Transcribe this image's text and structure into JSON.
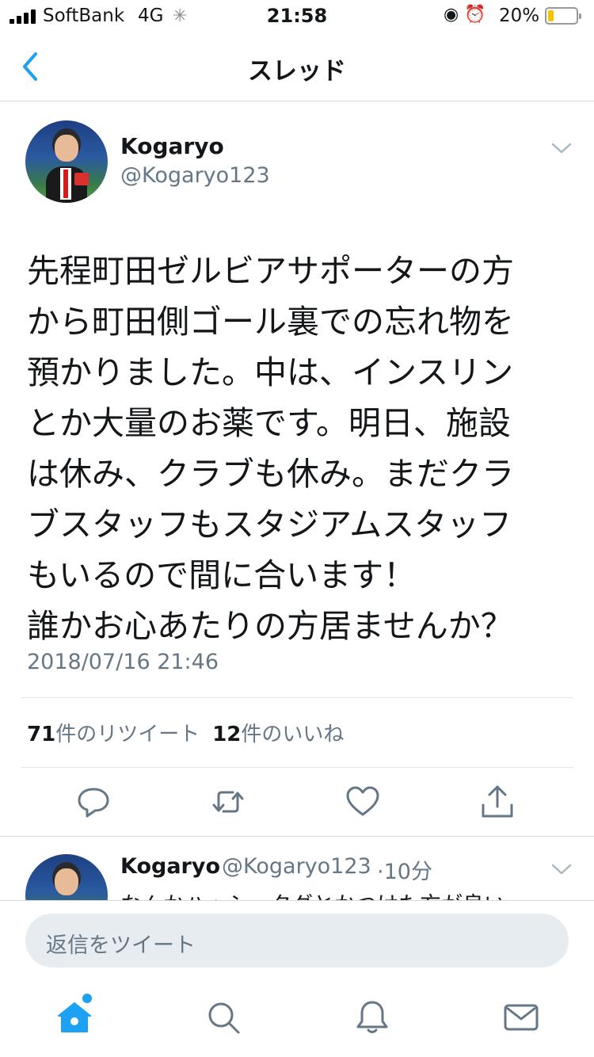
{
  "status_bar": {
    "carrier": "SoftBank",
    "network": "4G",
    "time": "21:58",
    "battery_percent": "20%",
    "battery_level": 0.2,
    "battery_color": "#f5c400"
  },
  "nav": {
    "title": "スレッド",
    "back_icon": "chevron-left-icon"
  },
  "tweet": {
    "display_name": "Kogaryo",
    "handle": "@Kogaryo123",
    "text_lines": [
      "先程町田ゼルビアサポーターの方",
      "から町田側ゴール裏での忘れ物を",
      "預かりました。中は、インスリン",
      "とか大量のお薬です。明日、施設",
      "は休み、クラブも休み。まだクラ",
      "ブスタッフもスタジアムスタッフ",
      "もいるので間に合います！",
      "誰かお心あたりの方居ませんか？"
    ],
    "timestamp": "2018/07/16 21:46",
    "retweet_count": "71",
    "retweet_label": "件のリツイート",
    "like_count": "12",
    "like_label": "件のいいね"
  },
  "actions": [
    "reply-icon",
    "retweet-icon",
    "like-icon",
    "share-icon"
  ],
  "reply_preview": {
    "display_name": "Kogaryo",
    "handle": "@Kogaryo123",
    "time": "·10分",
    "text": "なんかハッシュタグとかつけた方が良い"
  },
  "compose": {
    "placeholder": "返信をツイート"
  },
  "tabbar": [
    "home-icon",
    "search-icon",
    "notifications-icon",
    "messages-icon"
  ],
  "colors": {
    "accent": "#1da1f2",
    "secondary_text": "#657786",
    "divider": "#e1e8ed"
  }
}
